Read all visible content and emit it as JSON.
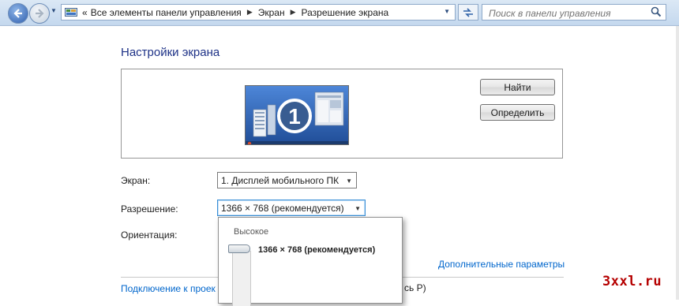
{
  "address_bar": {
    "overflow": "«",
    "breadcrumbs": [
      "Все элементы панели управления",
      "Экран",
      "Разрешение экрана"
    ]
  },
  "search": {
    "placeholder": "Поиск в панели управления"
  },
  "page": {
    "heading": "Настройки экрана"
  },
  "preview": {
    "monitor_number": "1",
    "identify_button": "Найти",
    "detect_button": "Определить"
  },
  "settings": {
    "display_label": "Экран:",
    "display_value": "1. Дисплей мобильного ПК",
    "resolution_label": "Разрешение:",
    "resolution_value": "1366 × 768 (рекомендуется)",
    "orientation_label": "Ориентация:"
  },
  "resolution_dropdown": {
    "top_label": "Высокое",
    "current_label": "1366 × 768 (рекомендуется)",
    "slider_level": 1.0
  },
  "links": {
    "advanced": "Дополнительные параметры",
    "connect_projector_partial": "Подключение к проек",
    "connect_projector_tail": "сь P)"
  },
  "watermark": "3xxl.ru",
  "colors": {
    "heading": "#1e3287",
    "link": "#0066cc",
    "watermark": "#b50000",
    "accent_focus": "#3a8fd6"
  },
  "icons": [
    "back-arrow-icon",
    "forward-arrow-icon",
    "control-panel-icon",
    "chevron-right-icon",
    "refresh-icon",
    "search-icon",
    "dropdown-arrow-icon"
  ]
}
